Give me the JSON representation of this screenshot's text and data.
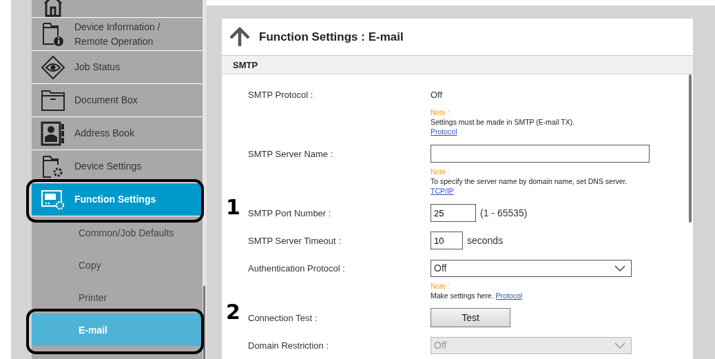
{
  "sidebar": {
    "items": [
      {
        "selected": false
      },
      {
        "label": "Device Information / Remote Operation",
        "selected": false
      },
      {
        "label": "Job Status",
        "selected": false
      },
      {
        "label": "Document Box",
        "selected": false
      },
      {
        "label": "Address Book",
        "selected": false
      },
      {
        "label": "Device Settings",
        "selected": false
      },
      {
        "label": "Function Settings",
        "selected": true
      }
    ],
    "subitems": [
      {
        "label": "Common/Job Defaults",
        "selected": false
      },
      {
        "label": "Copy",
        "selected": false
      },
      {
        "label": "Printer",
        "selected": false
      },
      {
        "label": "E-mail",
        "selected": true
      }
    ]
  },
  "page": {
    "title": "Function Settings : E-mail",
    "section": "SMTP",
    "rows": [
      {
        "kind": "text",
        "label": "SMTP Protocol :",
        "value": "Off"
      },
      {
        "kind": "note",
        "note_label": "Note :",
        "text": "Settings must be made in SMTP (E-mail TX).",
        "link": "Protocol"
      },
      {
        "kind": "input",
        "label": "SMTP Server Name :"
      },
      {
        "kind": "note",
        "note_label": "Note :",
        "text": "To specify the server name by domain name, set DNS server.",
        "link": "TCP/IP"
      },
      {
        "kind": "input",
        "label": "SMTP Port Number :",
        "value": "25",
        "suffix": "(1 - 65535)",
        "callout": "1"
      },
      {
        "kind": "input",
        "label": "SMTP Server Timeout :",
        "value": "10",
        "suffix": "seconds"
      },
      {
        "kind": "select",
        "label": "Authentication Protocol :",
        "value": "Off",
        "disabled": false
      },
      {
        "kind": "inline_note",
        "note_label": "Note :",
        "text": "Make settings here.",
        "link": "Protocol"
      },
      {
        "kind": "button",
        "label": "Connection Test :",
        "button": "Test",
        "callout": "2"
      },
      {
        "kind": "select",
        "label": "Domain Restriction :",
        "value": "Off",
        "disabled": true
      }
    ]
  }
}
